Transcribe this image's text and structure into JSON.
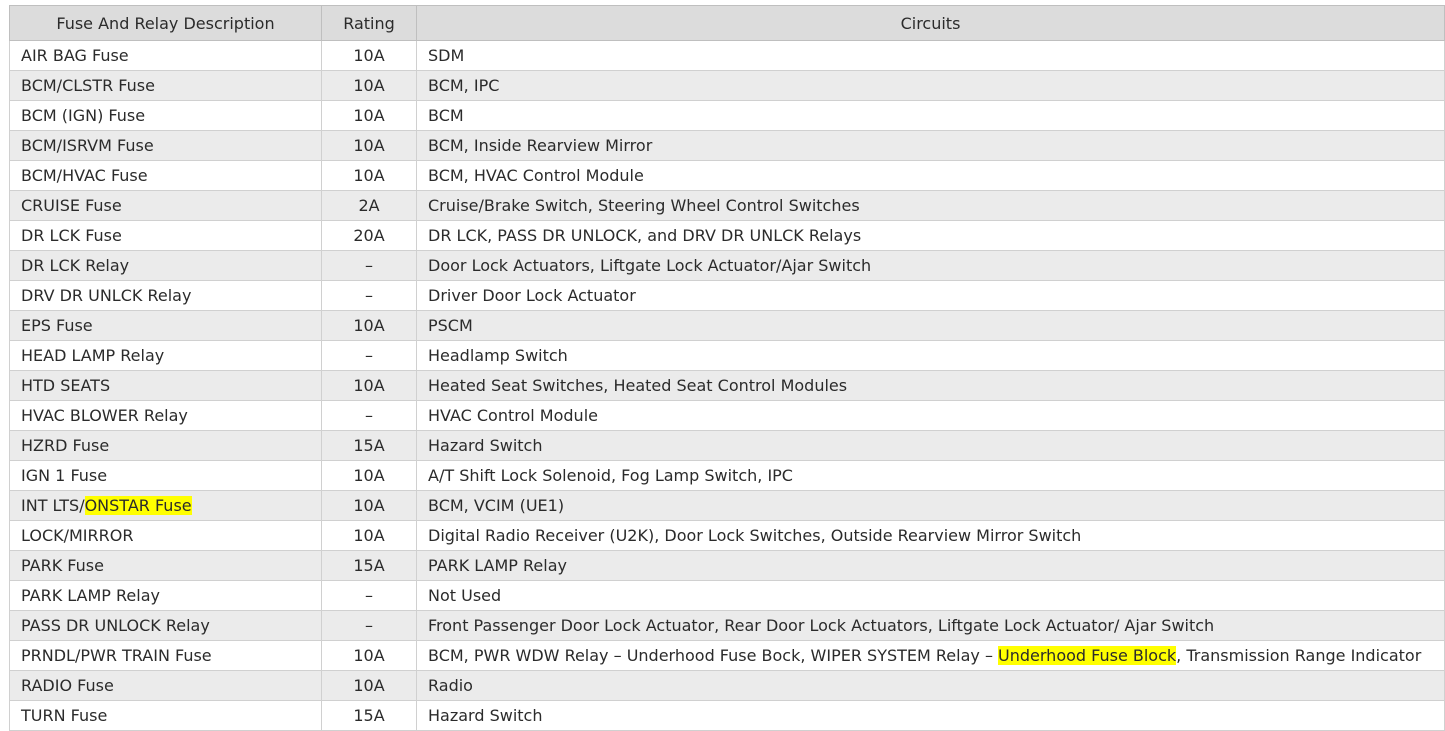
{
  "headers": {
    "description": "Fuse And Relay Description",
    "rating": "Rating",
    "circuits": "Circuits"
  },
  "rows": [
    {
      "description": "AIR BAG Fuse",
      "rating": "10A",
      "circuits": "SDM"
    },
    {
      "description": "BCM/CLSTR Fuse",
      "rating": "10A",
      "circuits": "BCM, IPC"
    },
    {
      "description": "BCM (IGN) Fuse",
      "rating": "10A",
      "circuits": "BCM"
    },
    {
      "description": "BCM/ISRVM Fuse",
      "rating": "10A",
      "circuits": "BCM, Inside Rearview Mirror"
    },
    {
      "description": "BCM/HVAC Fuse",
      "rating": "10A",
      "circuits": "BCM, HVAC Control Module"
    },
    {
      "description": "CRUISE Fuse",
      "rating": "2A",
      "circuits": "Cruise/Brake Switch, Steering Wheel Control Switches"
    },
    {
      "description": "DR LCK Fuse",
      "rating": "20A",
      "circuits": "DR LCK, PASS DR UNLOCK, and DRV DR UNLCK Relays"
    },
    {
      "description": "DR LCK Relay",
      "rating": "–",
      "circuits": "Door Lock Actuators, Liftgate Lock Actuator/Ajar Switch"
    },
    {
      "description": "DRV DR UNLCK Relay",
      "rating": "–",
      "circuits": "Driver Door Lock Actuator"
    },
    {
      "description": "EPS Fuse",
      "rating": "10A",
      "circuits": "PSCM"
    },
    {
      "description": "HEAD LAMP Relay",
      "rating": "–",
      "circuits": "Headlamp Switch"
    },
    {
      "description": "HTD SEATS",
      "rating": "10A",
      "circuits": "Heated Seat Switches, Heated Seat Control Modules"
    },
    {
      "description": "HVAC BLOWER Relay",
      "rating": "–",
      "circuits": "HVAC Control Module"
    },
    {
      "description": "HZRD Fuse",
      "rating": "15A",
      "circuits": "Hazard Switch"
    },
    {
      "description": "IGN 1 Fuse",
      "rating": "10A",
      "circuits": "A/T Shift Lock Solenoid, Fog Lamp Switch, IPC"
    },
    {
      "description": "INT LTS/",
      "description_highlight": "ONSTAR Fuse",
      "rating": "10A",
      "circuits": "BCM, VCIM (UE1)"
    },
    {
      "description": "LOCK/MIRROR",
      "rating": "10A",
      "circuits": "Digital Radio Receiver (U2K), Door Lock Switches, Outside Rearview Mirror Switch"
    },
    {
      "description": "PARK Fuse",
      "rating": "15A",
      "circuits": "PARK LAMP Relay"
    },
    {
      "description": "PARK LAMP Relay",
      "rating": "–",
      "circuits": "Not Used"
    },
    {
      "description": "PASS DR UNLOCK Relay",
      "rating": "–",
      "circuits": "Front Passenger Door Lock Actuator, Rear Door Lock Actuators, Liftgate Lock Actuator/ Ajar Switch"
    },
    {
      "description": "PRNDL/PWR TRAIN Fuse",
      "rating": "10A",
      "circuits": "BCM, PWR WDW Relay – Underhood Fuse Bock, WIPER SYSTEM Relay – ",
      "circuits_highlight": "Underhood Fuse Block",
      "circuits_after": ", Transmission Range Indicator"
    },
    {
      "description": "RADIO Fuse",
      "rating": "10A",
      "circuits": "Radio"
    },
    {
      "description": "TURN Fuse",
      "rating": "15A",
      "circuits": "Hazard Switch"
    }
  ],
  "highlight_color": "#ffff00"
}
